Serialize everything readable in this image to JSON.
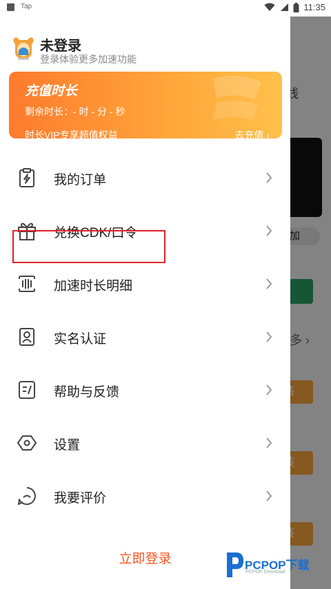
{
  "status_bar": {
    "app_label": "Tap",
    "time": "11:35"
  },
  "background": {
    "snippet_online": "线",
    "snippet_add": "加",
    "snippet_more": "多 ›",
    "snippet_install": "装"
  },
  "profile": {
    "name": "未登录",
    "subtitle": "登录体验更多加速功能"
  },
  "vip_card": {
    "title": "充值时长",
    "remaining": "剩余时长：- 时 - 分 - 秒",
    "subtitle": "时长VIP专享超值权益",
    "link": "去充值 ›"
  },
  "menu": {
    "items": [
      {
        "label": "我的订单",
        "icon": "clipboard-lightning-icon"
      },
      {
        "label": "兑换CDK/口令",
        "icon": "gift-icon"
      },
      {
        "label": "加速时长明细",
        "icon": "bars-detail-icon"
      },
      {
        "label": "实名认证",
        "icon": "id-card-icon"
      },
      {
        "label": "帮助与反馈",
        "icon": "help-feedback-icon"
      },
      {
        "label": "设置",
        "icon": "hexagon-settings-icon"
      },
      {
        "label": "我要评价",
        "icon": "smile-review-icon"
      }
    ]
  },
  "login_button": "立即登录",
  "watermark": {
    "brand": "PCPOP下载",
    "sub": "PCPOP Download"
  },
  "colors": {
    "accent": "#f5551f",
    "card_start": "#ff7b2e",
    "card_end": "#ffc04a",
    "highlight": "#e0202a"
  }
}
